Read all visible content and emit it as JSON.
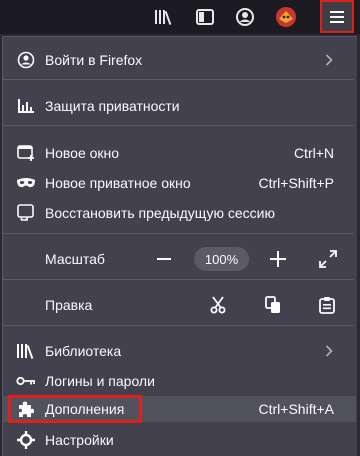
{
  "menu": {
    "sign_in": "Войти в Firefox",
    "privacy": "Защита приватности",
    "new_window": {
      "label": "Новое окно",
      "shortcut": "Ctrl+N"
    },
    "new_private_window": {
      "label": "Новое приватное окно",
      "shortcut": "Ctrl+Shift+P"
    },
    "restore_session": "Восстановить предыдущую сессию",
    "zoom": {
      "label": "Масштаб",
      "value": "100%"
    },
    "edit": {
      "label": "Правка"
    },
    "library": "Библиотека",
    "logins": "Логины и пароли",
    "addons": {
      "label": "Дополнения",
      "shortcut": "Ctrl+Shift+A"
    },
    "settings": "Настройки"
  },
  "colors": {
    "highlight": "#e0201a",
    "panel_bg": "#42414d",
    "toolbar_bg": "#1c1b22"
  }
}
